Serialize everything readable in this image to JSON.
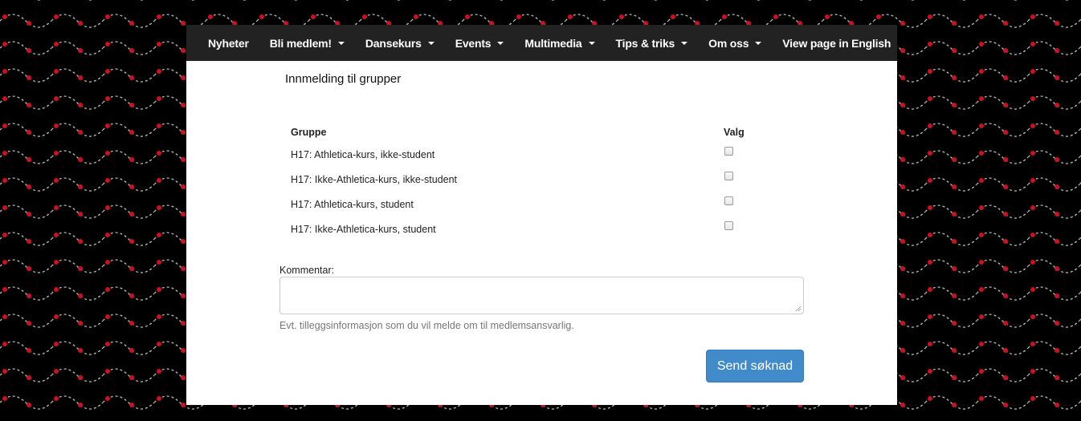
{
  "navbar": {
    "items": [
      {
        "label": "Nyheter",
        "dropdown": false
      },
      {
        "label": "Bli medlem!",
        "dropdown": true
      },
      {
        "label": "Dansekurs",
        "dropdown": true
      },
      {
        "label": "Events",
        "dropdown": true
      },
      {
        "label": "Multimedia",
        "dropdown": true
      },
      {
        "label": "Tips & triks",
        "dropdown": true
      },
      {
        "label": "Om oss",
        "dropdown": true
      },
      {
        "label": "View page in English",
        "dropdown": false
      }
    ]
  },
  "main": {
    "heading": "Innmelding til grupper",
    "table": {
      "headers": [
        "Gruppe",
        "Valg"
      ],
      "rows": [
        {
          "group": "H17: Athletica-kurs, ikke-student",
          "checked": false
        },
        {
          "group": "H17: Ikke-Athletica-kurs, ikke-student",
          "checked": false
        },
        {
          "group": "H17: Athletica-kurs, student",
          "checked": false
        },
        {
          "group": "H17: Ikke-Athletica-kurs, student",
          "checked": false
        }
      ]
    },
    "comment": {
      "label": "Kommentar:",
      "value": "",
      "help": "Evt. tilleggsinformasjon som du vil melde om til medlemsansvarlig."
    },
    "submit_label": "Send søknad"
  },
  "colors": {
    "background": "#000000",
    "wave_line": "#bbbbbb",
    "wave_dot": "#cc1122",
    "navbar": "#222222",
    "button": "#428bca"
  }
}
